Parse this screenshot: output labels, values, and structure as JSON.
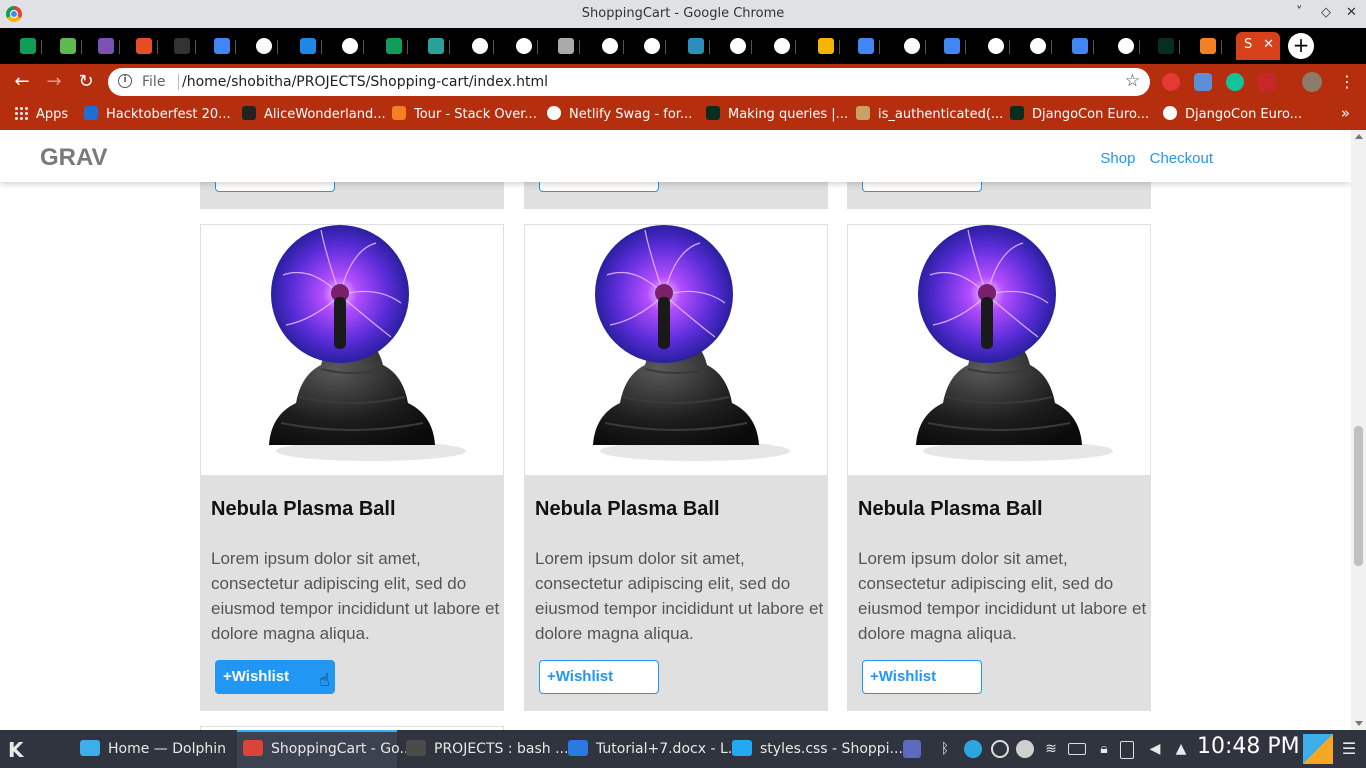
{
  "window": {
    "title": "ShoppingCart - Google Chrome",
    "controls": [
      "˅",
      "◇",
      "✕"
    ]
  },
  "tabs": {
    "favicon_colors": [
      "#0f9d58",
      "#5fb94e",
      "#7952b3",
      "#e44d26",
      "#333333",
      "#4285f4",
      "#ffffff",
      "#1e88e5",
      "#ffffff",
      "#0f9d58",
      "#2aa198",
      "#ffffff",
      "#ffffff",
      "#aaaaaa",
      "#ffffff",
      "#ffffff",
      "#2c8ebb",
      "#ffffff",
      "#ffffff",
      "#f4b400",
      "#4285f4",
      "#ffffff",
      "#4285f4",
      "#ffffff",
      "#ffffff",
      "#4285f4",
      "#ffffff",
      "#092e20",
      "#f48024"
    ],
    "active_label": "S",
    "new_tab": "+"
  },
  "toolbar": {
    "scheme": "File",
    "url": "/home/shobitha/PROJECTS/Shopping-cart/index.html",
    "back": "←",
    "forward": "→",
    "reload": "↻",
    "star": "☆"
  },
  "bookmarks": [
    {
      "label": "Apps",
      "icon": "apps-grid-icon"
    },
    {
      "label": "Hacktoberfest 20...",
      "icon_color": "#1d6fd6"
    },
    {
      "label": "AliceWonderland...",
      "icon_color": "#222222"
    },
    {
      "label": "Tour - Stack Over...",
      "icon_color": "#f48024"
    },
    {
      "label": "Netlify Swag - for...",
      "icon_color": "#ffffff"
    },
    {
      "label": "Making queries |...",
      "icon_color": "#092e20"
    },
    {
      "label": "is_authenticated(...",
      "icon_color": "#c9a066"
    },
    {
      "label": "DjangoCon Euro...",
      "icon_color": "#092e20"
    },
    {
      "label": "DjangoCon Euro...",
      "icon_color": "#ffffff"
    }
  ],
  "site": {
    "brand": "GRAV",
    "nav": [
      "Shop",
      "Checkout"
    ],
    "accent": "#2196f3"
  },
  "products": [
    {
      "name": "Nebula Plasma Ball",
      "description": "Lorem ipsum dolor sit amet, consectetur adipiscing elit, sed do eiusmod tempor incididunt ut labore et dolore magna aliqua.",
      "button": "+Wishlist",
      "hovered": true
    },
    {
      "name": "Nebula Plasma Ball",
      "description": "Lorem ipsum dolor sit amet, consectetur adipiscing elit, sed do eiusmod tempor incididunt ut labore et dolore magna aliqua.",
      "button": "+Wishlist",
      "hovered": false
    },
    {
      "name": "Nebula Plasma Ball",
      "description": "Lorem ipsum dolor sit amet, consectetur adipiscing elit, sed do eiusmod tempor incididunt ut labore et dolore magna aliqua.",
      "button": "+Wishlist",
      "hovered": false
    }
  ],
  "taskbar": {
    "tasks": [
      {
        "label": "Home — Dolphin",
        "icon_color": "#3daee9"
      },
      {
        "label": "ShoppingCart - Go...",
        "icon_color": "#db4437",
        "active": true
      },
      {
        "label": "PROJECTS : bash ...",
        "icon_color": "#4a4a4a"
      },
      {
        "label": "Tutorial+7.docx - L...",
        "icon_color": "#2a7ae2"
      },
      {
        "label": "styles.css - Shoppi...",
        "icon_color": "#23a9f2"
      }
    ],
    "clock": "10:48 PM"
  }
}
